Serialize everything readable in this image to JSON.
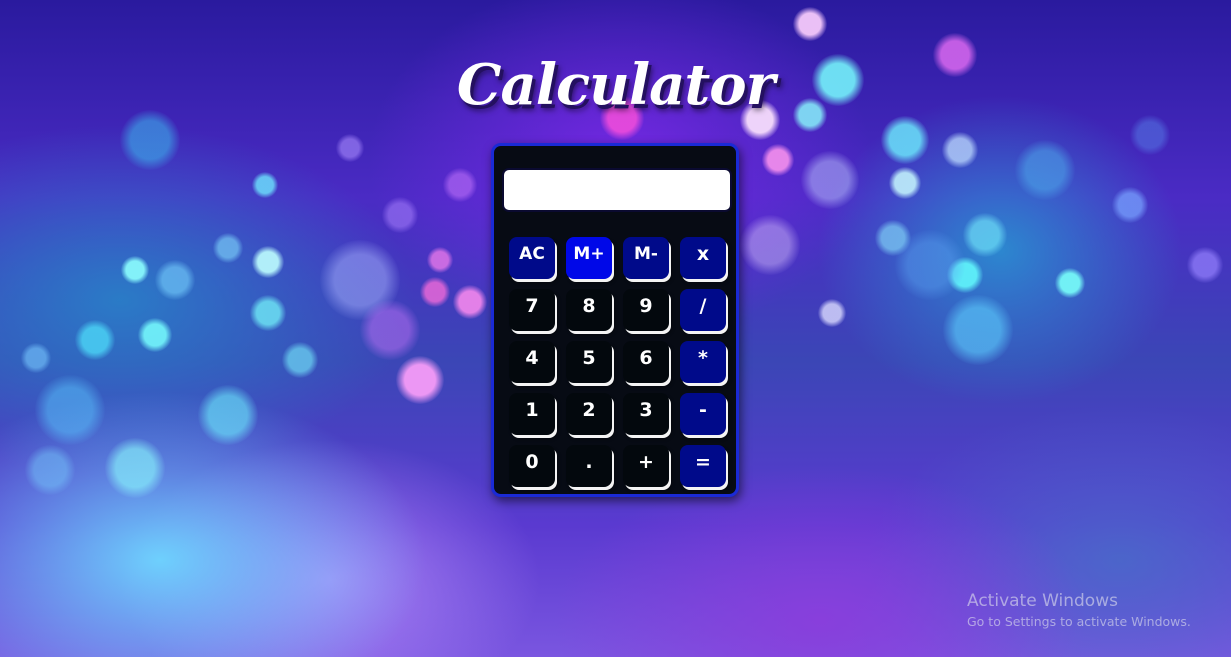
{
  "page": {
    "title": "Calculator"
  },
  "calculator": {
    "display_value": "",
    "keys": [
      {
        "label": "AC",
        "kind": "op",
        "name": "key-ac"
      },
      {
        "label": "M+",
        "kind": "op",
        "name": "key-m-plus",
        "state": "active"
      },
      {
        "label": "M-",
        "kind": "op",
        "name": "key-m-minus"
      },
      {
        "label": "x",
        "kind": "op",
        "name": "key-x"
      },
      {
        "label": "7",
        "kind": "num",
        "name": "key-7"
      },
      {
        "label": "8",
        "kind": "num",
        "name": "key-8"
      },
      {
        "label": "9",
        "kind": "num",
        "name": "key-9"
      },
      {
        "label": "/",
        "kind": "op",
        "name": "key-divide"
      },
      {
        "label": "4",
        "kind": "num",
        "name": "key-4"
      },
      {
        "label": "5",
        "kind": "num",
        "name": "key-5"
      },
      {
        "label": "6",
        "kind": "num",
        "name": "key-6"
      },
      {
        "label": "*",
        "kind": "op",
        "name": "key-multiply"
      },
      {
        "label": "1",
        "kind": "num",
        "name": "key-1"
      },
      {
        "label": "2",
        "kind": "num",
        "name": "key-2"
      },
      {
        "label": "3",
        "kind": "num",
        "name": "key-3"
      },
      {
        "label": "-",
        "kind": "op",
        "name": "key-subtract"
      },
      {
        "label": "0",
        "kind": "num",
        "name": "key-0"
      },
      {
        "label": ".",
        "kind": "num",
        "name": "key-decimal"
      },
      {
        "label": "+",
        "kind": "num",
        "name": "key-add"
      },
      {
        "label": "=",
        "kind": "op",
        "name": "key-equals"
      }
    ]
  },
  "colors": {
    "calculator_body": "#070b14",
    "calculator_border": "#1a2ad6",
    "number_key": "#03080d",
    "operator_key": "#000a8a",
    "active_key": "#0008e8",
    "display_background": "#ffffff"
  },
  "watermark": {
    "title": "Activate Windows",
    "subtitle": "Go to Settings to activate Windows."
  }
}
